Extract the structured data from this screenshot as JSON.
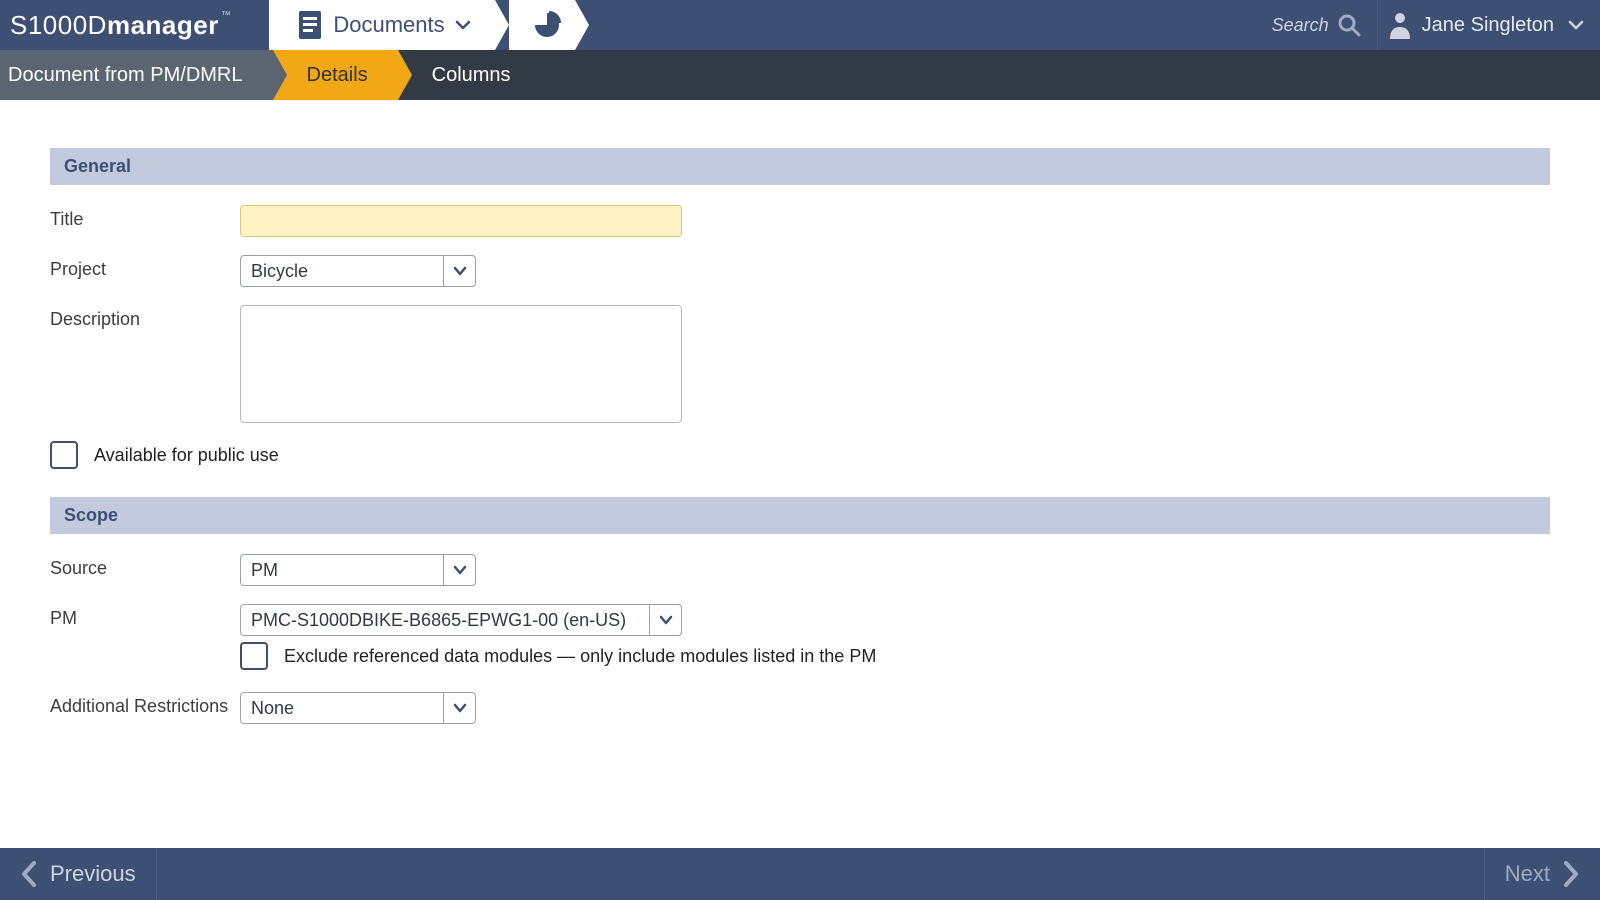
{
  "header": {
    "logo_light": "S1000D",
    "logo_bold": "manager",
    "nav_documents": "Documents",
    "search_label": "Search",
    "user_name": "Jane Singleton"
  },
  "wizard": {
    "step1": "Document from PM/DMRL",
    "step2": "Details",
    "step3": "Columns"
  },
  "sections": {
    "general": "General",
    "scope": "Scope"
  },
  "labels": {
    "title": "Title",
    "project": "Project",
    "description": "Description",
    "public_use": "Available for public use",
    "source": "Source",
    "pm": "PM",
    "exclude_ref": "Exclude referenced data modules — only include modules listed in the PM",
    "addl_restrictions": "Additional Restrictions"
  },
  "values": {
    "title": "",
    "project": "Bicycle",
    "description": "",
    "public_use_checked": false,
    "source": "PM",
    "pm": "PMC-S1000DBIKE-B6865-EPWG1-00 (en-US)",
    "exclude_ref_checked": false,
    "addl_restrictions": "None"
  },
  "footer": {
    "prev": "Previous",
    "next": "Next"
  }
}
